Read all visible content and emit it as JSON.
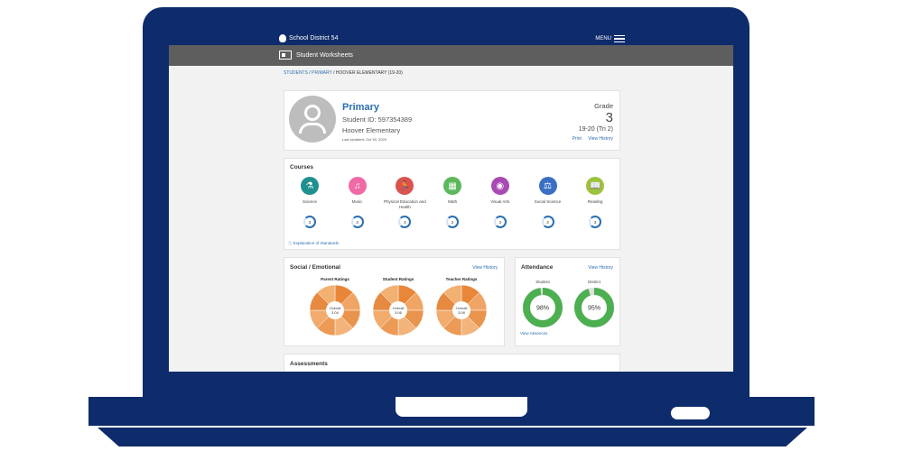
{
  "header": {
    "brand": "School District 54",
    "menu_label": "MENU",
    "section": "Student Worksheets"
  },
  "breadcrumb": [
    "STUDENTS",
    "PRIMARY",
    "HOOVER ELEMENTARY (19-20)"
  ],
  "profile": {
    "name": "Primary",
    "student_id": "Student ID: 597354389",
    "school": "Hoover Elementary",
    "updated": "Last Updated: Oct 30, 2020",
    "grade_label": "Grade",
    "grade": "3",
    "term": "19-20 (Tri 2)",
    "print": "Print",
    "view_history": "View History"
  },
  "courses": {
    "title": "Courses",
    "explanation": "Explanation of Standards",
    "items": [
      {
        "name": "Science",
        "score": "3",
        "color": "#1f8f8f",
        "icon": "microscope-icon",
        "glyph": "⚗"
      },
      {
        "name": "Music",
        "score": "3",
        "color": "#f06aa6",
        "icon": "music-icon",
        "glyph": "♫"
      },
      {
        "name": "Physical Education and Health",
        "score": "3",
        "color": "#d9534f",
        "icon": "runner-icon",
        "glyph": "🏃"
      },
      {
        "name": "Math",
        "score": "2",
        "color": "#5cb85c",
        "icon": "calculator-icon",
        "glyph": "▦"
      },
      {
        "name": "Visual Arts",
        "score": "3",
        "color": "#a84ab3",
        "icon": "palette-icon",
        "glyph": "◉"
      },
      {
        "name": "Social Science",
        "score": "3",
        "color": "#3a6fc4",
        "icon": "scale-icon",
        "glyph": "⚖"
      },
      {
        "name": "Reading",
        "score": "3",
        "color": "#9ac43c",
        "icon": "book-icon",
        "glyph": "📖"
      }
    ]
  },
  "social": {
    "title": "Social / Emotional",
    "view_history": "View History",
    "charts": [
      {
        "label": "Parent Ratings",
        "center_label": "Overall",
        "center_value": "3.04"
      },
      {
        "label": "Student Ratings",
        "center_label": "Overall",
        "center_value": "3.06"
      },
      {
        "label": "Teacher Ratings",
        "center_label": "Overall",
        "center_value": "3.08"
      }
    ]
  },
  "attendance": {
    "title": "Attendance",
    "view_history": "View History",
    "student_label": "Student",
    "student_pct": "98%",
    "student_value": 0.98,
    "district_label": "District",
    "district_pct": "95%",
    "district_value": 0.95,
    "view_absences": "View Absences",
    "color": "#4caf50"
  },
  "assessments": {
    "title": "Assessments"
  }
}
